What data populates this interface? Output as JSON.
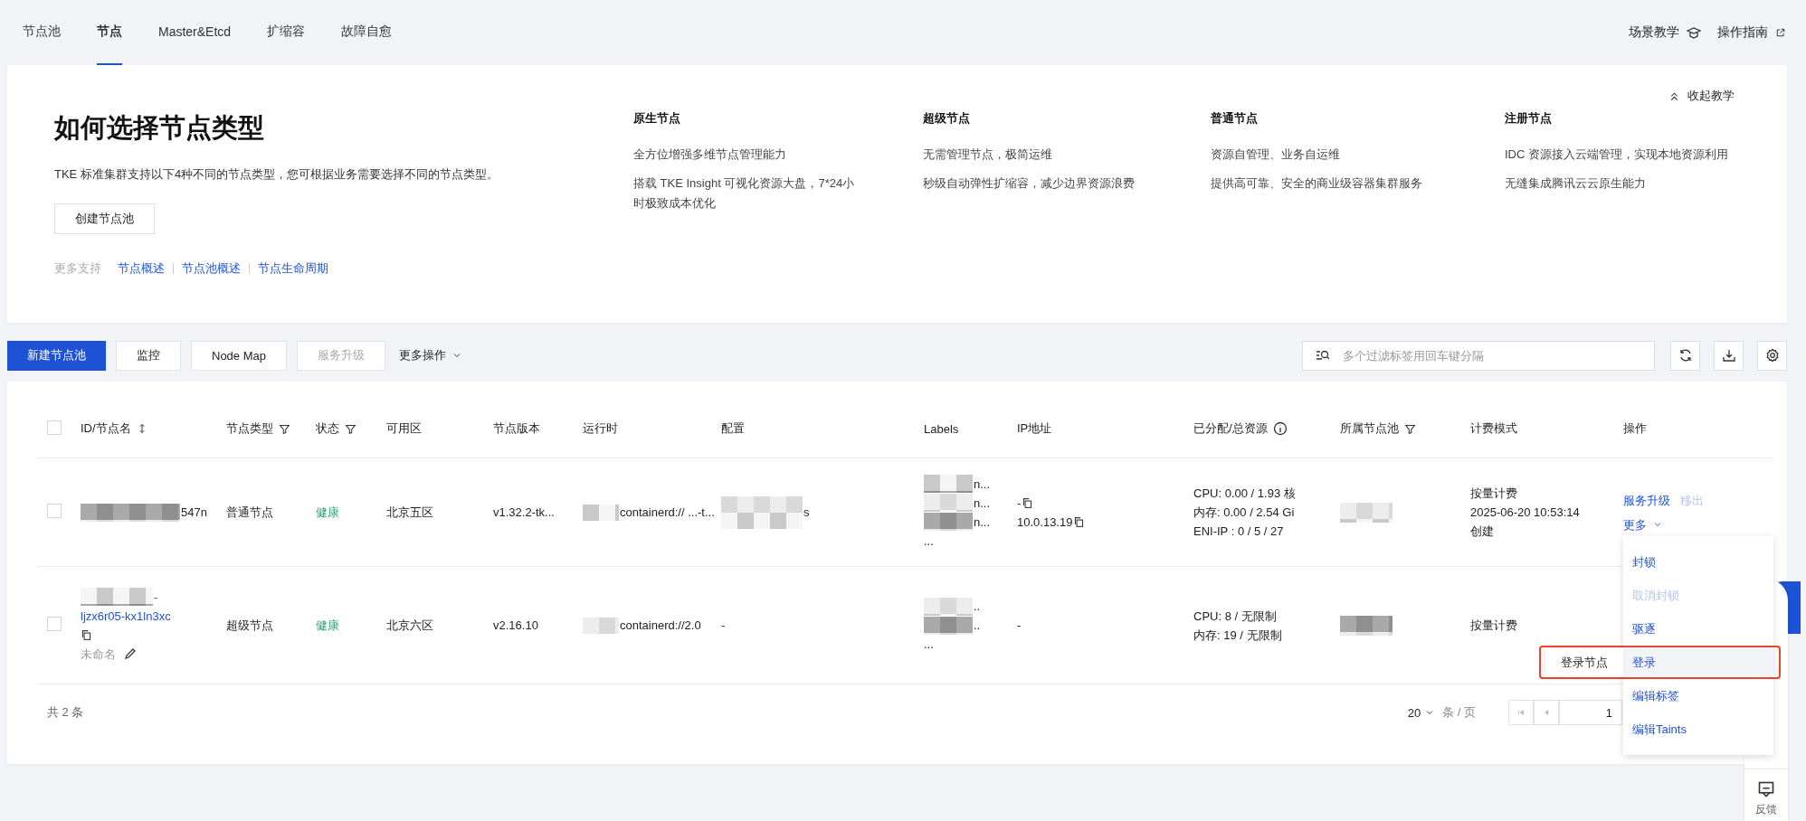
{
  "tabs": [
    {
      "label": "节点池",
      "selected": false
    },
    {
      "label": "节点",
      "selected": true
    },
    {
      "label": "Master&Etcd",
      "selected": false
    },
    {
      "label": "扩缩容",
      "selected": false
    },
    {
      "label": "故障自愈",
      "selected": false
    }
  ],
  "header_links": [
    {
      "label": "场景教学",
      "kind": "teach"
    },
    {
      "label": "操作指南",
      "kind": "external"
    }
  ],
  "guide": {
    "title": "如何选择节点类型",
    "description": "TKE 标准集群支持以下4种不同的节点类型，您可根据业务需要选择不同的节点类型。",
    "button": "创建节点池",
    "more_label": "更多支持",
    "links": [
      "节点概述",
      "节点池概述",
      "节点生命周期"
    ],
    "collapse": "收起教学",
    "types": [
      {
        "name": "原生节点",
        "points": [
          "全方位增强多维节点管理能力",
          "搭载 TKE Insight 可视化资源大盘，7*24小时极致成本优化"
        ]
      },
      {
        "name": "超级节点",
        "points": [
          "无需管理节点，极简运维",
          "秒级自动弹性扩缩容，减少边界资源浪费"
        ]
      },
      {
        "name": "普通节点",
        "points": [
          "资源自管理、业务自运维",
          "提供高可靠、安全的商业级容器集群服务"
        ]
      },
      {
        "name": "注册节点",
        "points": [
          "IDC 资源接入云端管理，实现本地资源利用",
          "无缝集成腾讯云云原生能力"
        ]
      }
    ]
  },
  "toolbar": {
    "buttons": [
      {
        "label": "新建节点池",
        "kind": "primary"
      },
      {
        "label": "监控",
        "kind": "default"
      },
      {
        "label": "Node Map",
        "kind": "default"
      },
      {
        "label": "服务升级",
        "kind": "disabled"
      },
      {
        "label": "更多操作",
        "kind": "menu"
      }
    ],
    "search": {
      "placeholder": "多个过滤标签用回车键分隔"
    }
  },
  "table": {
    "select_all": false,
    "columns": [
      {
        "label": "ID/节点名",
        "kind": "sort"
      },
      {
        "label": "节点类型",
        "kind": "filter"
      },
      {
        "label": "状态",
        "kind": "filter"
      },
      {
        "label": "可用区",
        "kind": "plain"
      },
      {
        "label": "节点版本",
        "kind": "plain"
      },
      {
        "label": "运行时",
        "kind": "plain"
      },
      {
        "label": "配置",
        "kind": "plain"
      },
      {
        "label": "Labels",
        "kind": "plain"
      },
      {
        "label": "IP地址",
        "kind": "plain"
      },
      {
        "label": "已分配/总资源",
        "kind": "info"
      },
      {
        "label": "所属节点池",
        "kind": "filter"
      },
      {
        "label": "计费模式",
        "kind": "plain"
      },
      {
        "label": "操作",
        "kind": "plain"
      }
    ],
    "rows": [
      {
        "checked": false,
        "id": [
          "547n"
        ],
        "id_link": false,
        "type": "普通节点",
        "status": "健康",
        "zone": "北京五区",
        "version": "v1.32.2-tk...",
        "runtime": "containerd:// ...-t...",
        "config": "s",
        "labels": [
          "n...",
          "n...",
          "n..."
        ],
        "labels_more": "...",
        "ip": [
          {
            "text": "-",
            "copy": true
          },
          {
            "text": "10.0.13.19",
            "copy": true
          }
        ],
        "resources": [
          "CPU: 0.00 / 1.93 核",
          "内存: 0.00 / 2.54 Gi",
          "ENI-IP : 0 / 5 / 27"
        ],
        "billing": [
          "按量计费",
          "2025-06-20 10:53:14",
          "创建"
        ],
        "actions": [
          {
            "label": "服务升级",
            "disabled": false
          },
          {
            "label": "移出",
            "disabled": true
          }
        ],
        "more": "更多"
      },
      {
        "checked": false,
        "id": [
          "-",
          "ljzx6r05-kx1ln3xc"
        ],
        "id_link": true,
        "name": "未命名",
        "type": "超级节点",
        "status": "健康",
        "zone": "北京六区",
        "version": "v2.16.10",
        "runtime": "containerd://2.0",
        "config": "-",
        "labels": [
          "..",
          ".."
        ],
        "labels_more": "...",
        "ip": [
          {
            "text": "-",
            "copy": false
          }
        ],
        "resources": [
          "CPU: 8 / 无限制",
          "内存: 19 / 无限制"
        ],
        "billing": [
          "按量计费"
        ]
      }
    ]
  },
  "footer": {
    "total": "共 2 条",
    "page_size": "20",
    "per_page": "条 / 页",
    "page": "1"
  },
  "menu": {
    "items": [
      {
        "label": "封锁",
        "disabled": false,
        "highlighted": false
      },
      {
        "label": "取消封锁",
        "disabled": true,
        "highlighted": false
      },
      {
        "label": "驱逐",
        "disabled": false,
        "highlighted": false
      },
      {
        "label": "登录",
        "disabled": false,
        "highlighted": true
      },
      {
        "label": "编辑标签",
        "disabled": false,
        "highlighted": false
      },
      {
        "label": "编辑Taints",
        "disabled": false,
        "highlighted": false
      }
    ],
    "tooltip": "登录节点"
  },
  "feedback": "反馈"
}
